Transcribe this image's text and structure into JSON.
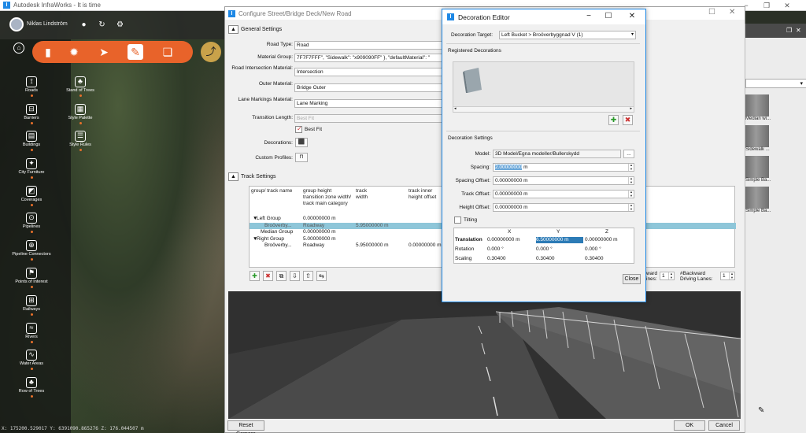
{
  "app": {
    "title": "Autodesk InfraWorks - It is time",
    "user_name": "Niklas Lindström",
    "coordinates": "X: 175200.529017 Y: 6391090.865276 Z: 176.044507 m"
  },
  "sidebar": {
    "items": [
      {
        "label": "Roads",
        "icon": "road-icon"
      },
      {
        "label": "Stand of Trees",
        "icon": "trees-icon"
      },
      {
        "label": "Barriers",
        "icon": "barrier-icon"
      },
      {
        "label": "Style Palette",
        "icon": "palette-icon"
      },
      {
        "label": "Buildings",
        "icon": "building-icon"
      },
      {
        "label": "Style Rules",
        "icon": "rules-icon"
      },
      {
        "label": "City Furniture",
        "icon": "furniture-icon"
      },
      {
        "label": "Coverages",
        "icon": "coverage-icon"
      },
      {
        "label": "Pipelines",
        "icon": "pipeline-icon"
      },
      {
        "label": "Pipeline Connectors",
        "icon": "connector-icon"
      },
      {
        "label": "Points of Interest",
        "icon": "poi-icon"
      },
      {
        "label": "Railways",
        "icon": "railway-icon"
      },
      {
        "label": "Rivers",
        "icon": "river-icon"
      },
      {
        "label": "Water Areas",
        "icon": "water-icon"
      },
      {
        "label": "Row of Trees",
        "icon": "tree-row-icon"
      }
    ]
  },
  "configure": {
    "title": "Configure Street/Bridge Deck/New Road",
    "general_settings": "General Settings",
    "fields": {
      "road_type_label": "Road Type:",
      "road_type": "Road",
      "material_group_label": "Material Group:",
      "material_group": "7F7F7FFF\", \"Sidewalk\": \"x909090FF\" }, \"defaultMaterial\": \"",
      "intersection_label": "Road Intersection Material:",
      "intersection": "Intersection",
      "outer_label": "Outer Material:",
      "outer": "Bridge Outer",
      "lane_label": "Lane Markings Material:",
      "lane": "Lane Marking",
      "transition_label": "Transition Length:",
      "transition_placeholder": "Best Fit",
      "best_fit": "Best Fit",
      "decorations_label": "Decorations:",
      "custom_profiles_label": "Custom Profiles:"
    },
    "track_settings": "Track Settings",
    "grid_headers": {
      "col1": "group/ track name",
      "col2": "group height transition zone width/ track main category",
      "col3": "track width",
      "col4": "track inner height offset"
    },
    "grid_rows": [
      {
        "name": "Left Group",
        "value": "0.00000000 m",
        "width": "",
        "offset": "",
        "indent": 1,
        "arrow": "▼"
      },
      {
        "name": "Broöverby...",
        "value": "Roadway",
        "width": "5.95000000 m",
        "offset": "",
        "indent": 3,
        "arrow": "",
        "selected": true
      },
      {
        "name": "Median Group",
        "value": "0.00000000 m",
        "width": "",
        "offset": "",
        "indent": 2,
        "arrow": ""
      },
      {
        "name": "Right Group",
        "value": "5.00000000 m",
        "width": "",
        "offset": "",
        "indent": 1,
        "arrow": "▼"
      },
      {
        "name": "Broöverby...",
        "value": "Roadway",
        "width": "5.95000000 m",
        "offset": "0.00000000 m",
        "indent": 3,
        "arrow": ""
      }
    ],
    "backward_label_a": "ward",
    "backward_label_b": "ines:",
    "backward_label_c": "#Backward",
    "backward_label_d": "Driving Lanes:",
    "lanes_value_1": "1",
    "lanes_value_2": "1",
    "reset_camera": "Reset Camera",
    "ok": "OK",
    "cancel": "Cancel"
  },
  "right_panel": {
    "items": [
      "Median wi...",
      "Sidewalk ...",
      "Simple Ba...",
      "Simple Ba..."
    ]
  },
  "decoration_editor": {
    "title": "Decoration Editor",
    "target_label": "Decoration Target:",
    "target_value": "Left Bucket > Broöverbyggnad V (1)",
    "registered_label": "Registered Decorations",
    "settings_label": "Decoration Settings",
    "model_label": "Model:",
    "model_value": "3D Model/Egna modeller/Bullerskydd",
    "model_browse": "...",
    "spacing_label": "Spacing:",
    "spacing_value": "2.00000000",
    "spacing_unit": "m",
    "spacing_offset_label": "Spacing Offset:",
    "spacing_offset_value": "0.00000000 m",
    "track_offset_label": "Track Offset:",
    "track_offset_value": "0.00000000 m",
    "height_offset_label": "Height Offset:",
    "height_offset_value": "0.00000000 m",
    "tilting_label": "Tilting",
    "table": {
      "headers": [
        "X",
        "Y",
        "Z"
      ],
      "rows": [
        {
          "label": "Translation",
          "x": "0.00000000 m",
          "y": "6.50000000 m",
          "z": "0.00000000 m"
        },
        {
          "label": "Rotation",
          "x": "0.000 °",
          "y": "0.000 °",
          "z": "0.000 °"
        },
        {
          "label": "Scaling",
          "x": "0.30400",
          "y": "0.30400",
          "z": "0.30400"
        }
      ]
    },
    "close": "Close"
  },
  "colors": {
    "accent": "#e8632a",
    "select": "#8ec6d9",
    "dialog_border": "#1e88e5"
  }
}
